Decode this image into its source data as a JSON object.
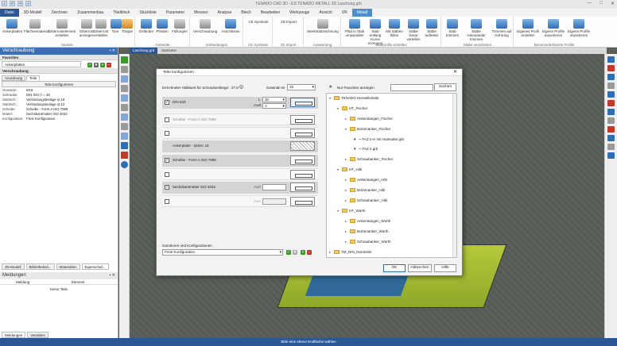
{
  "app": {
    "title": "TENADO CAD 3D - ES:TENADO METALL 3D Laschung.grb",
    "quick_access": [
      "save",
      "undo",
      "redo",
      "new"
    ],
    "window_controls": [
      "—",
      "□",
      "✕"
    ]
  },
  "ribbon_tabs": [
    "Datei",
    "3D-Modell",
    "Zeichnen",
    "Zusammenbau",
    "Titelblock",
    "Stückliste",
    "Parameter",
    "Messen",
    "Analyse",
    "Blech",
    "Bearbeiten",
    "Werkzeuge",
    "Ansicht",
    "VR",
    "Metall"
  ],
  "ribbon": {
    "groups": [
      {
        "label": "Module",
        "buttons": [
          "Ankerplatten",
          "Flächenmaterial",
          "Gitterrostelement erstellen",
          "Gitterrost anzeigen",
          "Gitterrost erstellen",
          "Tore",
          "Treppe"
        ]
      },
      {
        "label": "Geländer",
        "buttons": [
          "Geländer",
          "Pfosten",
          "Füllungen"
        ]
      },
      {
        "label": "Verbindungen",
        "buttons": [
          "Verschraubung",
          "Anschlüsse"
        ]
      },
      {
        "label": "CE Symbole",
        "buttons": [
          "CE Symbole"
        ]
      },
      {
        "label": "2D Import",
        "buttons": [
          "2D Import"
        ]
      },
      {
        "label": "Auswertung",
        "buttons": [
          "Werkstattzeichnung"
        ]
      },
      {
        "label": "Stabprofile erstellen",
        "buttons": [
          "Pfad in Stab umwandeln",
          "Stab entlang Kurve erzeugen",
          "Mit Stäben füllen",
          "Stäbe linear verteilen",
          "Stäbe aufteilen"
        ]
      },
      {
        "label": "Stäbe verarbeiten",
        "buttons": [
          "Stab trimmen",
          "Stäbe miteinander trimmen",
          "Trimmen auf Gehrung"
        ]
      },
      {
        "label": "Benutzerdefinierte Profile",
        "buttons": [
          "Eigenes Profil erstellen",
          "Eigene Profile exportieren",
          "Eigene Profile importieren"
        ]
      }
    ]
  },
  "left_panel": {
    "title": "Verschraubung",
    "favorites_section": "Favoriten",
    "favorite_value": "Ankerplatten",
    "section": "Verschraubung",
    "subtabs": [
      "Anordnung",
      "Teile"
    ],
    "config_button": "Teile konfigurieren",
    "properties": [
      {
        "k": "Gewinde:",
        "v": "M16"
      },
      {
        "k": "Schraube:",
        "v": "DIN 933 | l = 30"
      },
      {
        "k": "Stahlsch.:",
        "v": "Verbindungsbeilage st.18"
      },
      {
        "k": "Stahlsch.:",
        "v": "Verbindungsbeilage st.12"
      },
      {
        "k": "Scheibe:",
        "v": "Scheibe - Form A ISO 7089"
      },
      {
        "k": "Mutter:",
        "v": "Sechskantmutter ISO 4032"
      },
      {
        "k": "Konfiguration:",
        "v": "Freie Konfiguration"
      }
    ],
    "bottom_tabs": [
      "3D-Modell",
      "Bibliotheksd...",
      "Materialien",
      "Eigenschaf..."
    ],
    "messages": {
      "title": "Meldungen",
      "columns": [
        "Meldung",
        "Element"
      ],
      "empty": "Keine Teile",
      "tabs": [
        "Meldungen",
        "Variablen"
      ]
    }
  },
  "doc_tabs": [
    "Laschung.grb",
    "Startseite"
  ],
  "status": "Bitte eine ebene Endfläche wählen",
  "dialog": {
    "title": "Teile konfigurieren",
    "clamp_label": "Errechneter Hälbwert für Schraubenlänge:",
    "clamp_value": "27.8",
    "thread_label": "Gewinde M",
    "thread_value": "16",
    "length_label": "L",
    "length_value": "30",
    "ausf_label": "Ausf.",
    "ausf_value": "A",
    "parts": [
      {
        "name": "DIN 933",
        "checked": true,
        "dark": true
      },
      {
        "name": "Scheibe - Form A ISO 7089",
        "checked": false,
        "dark": false
      },
      {
        "name": "",
        "checked": false,
        "dark": false
      },
      {
        "name": "Ankerplatte  -  Dicke: 18",
        "checked": false,
        "dark": true
      },
      {
        "name": "Scheibe - Form A ISO 7089",
        "checked": true,
        "dark": false
      },
      {
        "name": "",
        "checked": false,
        "dark": false
      },
      {
        "name": "Sechskantmutter ISO 4032",
        "checked": true,
        "dark": true
      },
      {
        "name": "",
        "checked": false,
        "dark": false
      }
    ],
    "favorites_only": "Nur Favoriten anzeigen",
    "search_button": "Suchen",
    "tree": [
      {
        "level": 0,
        "label": "TENADO Herstellerteile",
        "type": "folder",
        "open": true
      },
      {
        "level": 1,
        "label": "HT_Fischer",
        "type": "folder",
        "open": true
      },
      {
        "level": 2,
        "label": "Ankerstangen_Fischer",
        "type": "folder"
      },
      {
        "level": 2,
        "label": "Bolzenanker_Fischer",
        "type": "folder",
        "open": true
      },
      {
        "level": 3,
        "label": "FAZ II-H mit Hutmutter.grb",
        "type": "file"
      },
      {
        "level": 3,
        "label": "FAZ II.grb",
        "type": "file"
      },
      {
        "level": 2,
        "label": "Schraubanker_Fischer",
        "type": "folder"
      },
      {
        "level": 1,
        "label": "HT_Hilti",
        "type": "folder",
        "open": true
      },
      {
        "level": 2,
        "label": "Ankerstangen_Hilti",
        "type": "folder"
      },
      {
        "level": 2,
        "label": "Bolzenanker_Hilti",
        "type": "folder"
      },
      {
        "level": 2,
        "label": "Schraubanker_Hilti",
        "type": "folder"
      },
      {
        "level": 1,
        "label": "HT_Würth",
        "type": "folder",
        "open": true
      },
      {
        "level": 2,
        "label": "Ankerstangen_Würth",
        "type": "folder"
      },
      {
        "level": 2,
        "label": "Bolzenanker_Würth",
        "type": "folder"
      },
      {
        "level": 2,
        "label": "Schraubanker_Würth",
        "type": "folder"
      },
      {
        "level": 0,
        "label": "TM_DIN_Normteile",
        "type": "folder"
      }
    ],
    "combos_label": "Garnituren und Konfigurationen",
    "combo_value": "Freie Konfiguration",
    "buttons": {
      "ok": "OK",
      "cancel": "Abbrechen",
      "help": "Hilfe"
    }
  },
  "colors": {
    "accent": "#2b5797",
    "metal_tab": "#4a8fd0",
    "panel_head": "#3c6eb4"
  }
}
